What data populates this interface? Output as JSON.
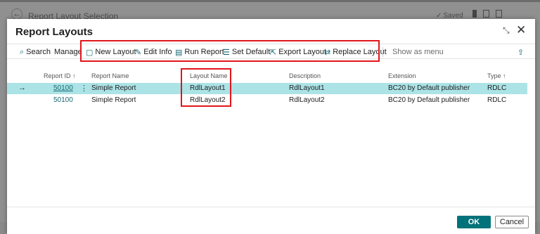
{
  "background": {
    "title": "Report Layout Selection",
    "saved_label": "Saved"
  },
  "dialog": {
    "title": "Report Layouts"
  },
  "actions": {
    "search": "Search",
    "manage": "Manage",
    "new_layout": "New Layout",
    "edit_info": "Edit Info",
    "run_report": "Run Report",
    "set_default": "Set Default",
    "export_layout": "Export Layout",
    "replace_layout": "Replace Layout",
    "show_as_menu": "Show as menu"
  },
  "table": {
    "columns": {
      "report_id": "Report ID ↑",
      "report_name": "Report Name",
      "layout_name": "Layout Name",
      "description": "Description",
      "extension": "Extension",
      "type": "Type ↑"
    },
    "rows": [
      {
        "report_id": "50100",
        "report_name": "Simple Report",
        "layout_name": "RdlLayout1",
        "description": "RdlLayout1",
        "extension": "BC20 by Default publisher",
        "type": "RDLC"
      },
      {
        "report_id": "50100",
        "report_name": "Simple Report",
        "layout_name": "RdlLayout2",
        "description": "RdlLayout2",
        "extension": "BC20 by Default publisher",
        "type": "RDLC"
      }
    ]
  },
  "buttons": {
    "ok": "OK",
    "cancel": "Cancel"
  },
  "colors": {
    "accent": "#00727A",
    "selected_row": "#ABE3E6",
    "highlight_box": "#E0161B"
  }
}
